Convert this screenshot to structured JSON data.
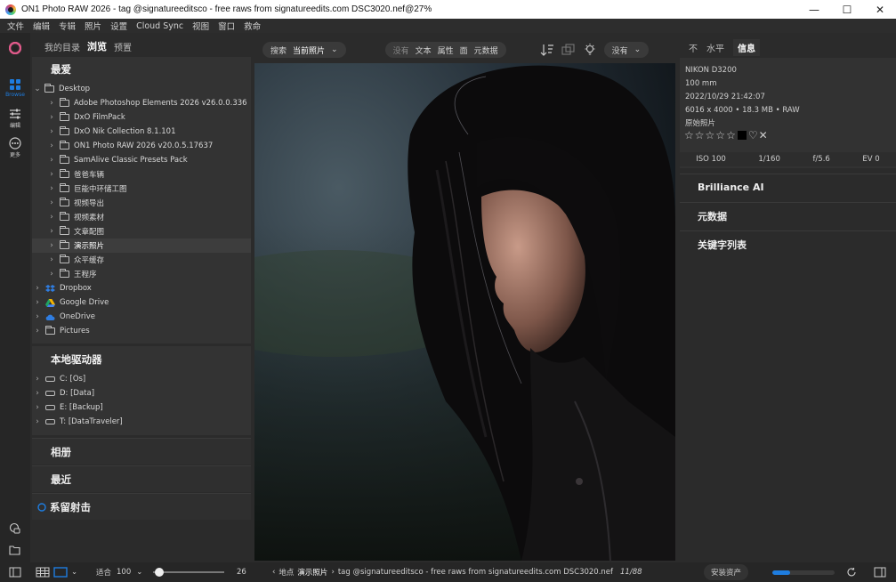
{
  "window": {
    "title": "ON1 Photo RAW 2026 - tag @signatureeditsco - free raws from signatureedits.com DSC3020.nef@27%",
    "minimize": "—",
    "maximize": "☐",
    "close": "✕"
  },
  "menu": [
    "文件",
    "编辑",
    "专辑",
    "照片",
    "设置",
    "Cloud Sync",
    "视图",
    "窗口",
    "救命"
  ],
  "left_toolbar": {
    "browse_label": "Browse",
    "edit_label": "编辑",
    "more_label": "更多"
  },
  "left_panel": {
    "tabs": [
      "我的目录",
      "浏览",
      "预置"
    ],
    "active_tab": "浏览",
    "favorites": {
      "title": "最爱",
      "root": "Desktop",
      "folders": [
        "Adobe Photoshop Elements 2026 v26.0.0.336",
        "DxO FilmPack",
        "DxO Nik Collection 8.1.101",
        "ON1 Photo RAW 2026 v20.0.5.17637",
        "SamAlive Classic Presets Pack",
        "爸爸车辆",
        "巨能中环储工图",
        "视频导出",
        "视频素材",
        "文章配图",
        "演示照片",
        "众平缓存",
        "王程序"
      ],
      "selected": "演示照片",
      "cloud": [
        "Dropbox",
        "Google Drive",
        "OneDrive",
        "Pictures"
      ]
    },
    "local_drives": {
      "title": "本地驱动器",
      "drives": [
        "C: [Os]",
        "D: [Data]",
        "E: [Backup]",
        "T: [DataTraveler]"
      ]
    },
    "albums": "相册",
    "recent": "最近",
    "tethered": "系留射击"
  },
  "center_toolbar": {
    "search_label": "搜索",
    "search_scope": "当前照片",
    "filters": [
      "没有",
      "文本",
      "属性",
      "面",
      "元数据"
    ],
    "sort_dropdown": "没有"
  },
  "right_panel": {
    "tabs": [
      "不",
      "水平",
      "信息"
    ],
    "active_tab": "信息",
    "camera": "NIKON D3200",
    "focal_length": "100 mm",
    "datetime": "2022/10/29  21:42:07",
    "dimensions": "6016 x 4000 • 18.3 MB • RAW",
    "label": "原始照片",
    "exif": [
      "ISO 100",
      "1/160",
      "f/5.6",
      "EV 0"
    ],
    "sections": [
      "Brilliance AI",
      "元数据",
      "关键字列表"
    ]
  },
  "bottom_bar": {
    "fit_label": "适合",
    "zoom": "100",
    "thumb_size": "26",
    "location_label": "地点",
    "location_folder": "演示照片",
    "file_path": "tag @signatureeditsco - free raws from signatureedits.com DSC3020.nef",
    "count": "11/88",
    "install_assets": "安装资产",
    "progress": 0.28
  },
  "colors": {
    "accent": "#1e7de0",
    "background": "#2b2b2b"
  }
}
